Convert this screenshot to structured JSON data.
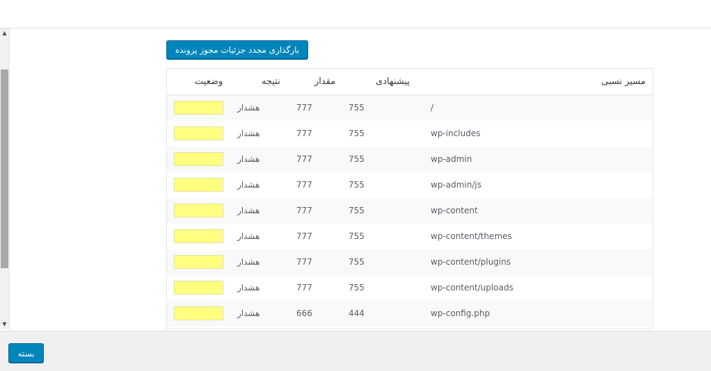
{
  "toolbar": {
    "reload_label": "بارگذاری مجدد جزئیات مجوز پرونده"
  },
  "table": {
    "headers": {
      "path": "مسیر نسبی",
      "suggested": "پیشنهادی",
      "value": "مقدار",
      "result": "نتیجه",
      "status": "وضعیت"
    },
    "rows": [
      {
        "path": "/",
        "suggested": "755",
        "value": "777",
        "result": "هشدار",
        "status_color": "#ffff80"
      },
      {
        "path": "wp-includes",
        "suggested": "755",
        "value": "777",
        "result": "هشدار",
        "status_color": "#ffff80"
      },
      {
        "path": "wp-admin",
        "suggested": "755",
        "value": "777",
        "result": "هشدار",
        "status_color": "#ffff80"
      },
      {
        "path": "wp-admin/js",
        "suggested": "755",
        "value": "777",
        "result": "هشدار",
        "status_color": "#ffff80"
      },
      {
        "path": "wp-content",
        "suggested": "755",
        "value": "777",
        "result": "هشدار",
        "status_color": "#ffff80"
      },
      {
        "path": "wp-content/themes",
        "suggested": "755",
        "value": "777",
        "result": "هشدار",
        "status_color": "#ffff80"
      },
      {
        "path": "wp-content/plugins",
        "suggested": "755",
        "value": "777",
        "result": "هشدار",
        "status_color": "#ffff80"
      },
      {
        "path": "wp-content/uploads",
        "suggested": "755",
        "value": "777",
        "result": "هشدار",
        "status_color": "#ffff80"
      },
      {
        "path": "wp-config.php",
        "suggested": "444",
        "value": "666",
        "result": "هشدار",
        "status_color": "#ffff80"
      }
    ]
  },
  "footer": {
    "close_label": "بسته"
  },
  "scrollbar": {
    "up_icon": "arrow-up-icon",
    "down_icon": "arrow-down-icon"
  },
  "colors": {
    "primary_button": "#0085ba",
    "warning_status": "#ffff80"
  }
}
